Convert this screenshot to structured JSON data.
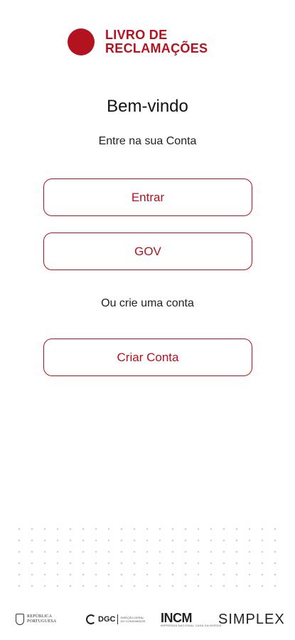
{
  "brand": {
    "line1": "LIVRO DE",
    "line2": "RECLAMAÇÕES",
    "color": "#b3121f"
  },
  "welcome": {
    "title": "Bem-vindo",
    "subtitle": "Entre na sua Conta"
  },
  "buttons": {
    "login": "Entrar",
    "gov": "GOV",
    "create": "Criar Conta"
  },
  "divider_text": "Ou crie uma conta",
  "footer": {
    "republica_line1": "REPÚBLICA",
    "republica_line2": "PORTUGUESA",
    "dgc_name": "DGC",
    "dgc_sub1": "DIREÇÃO-GERAL",
    "dgc_sub2": "DO CONSUMIDOR",
    "ncm_name": "INCM",
    "ncm_sub": "IMPRENSA NACIONAL CASA DA MOEDA",
    "simplex": "SIMPLEX"
  }
}
